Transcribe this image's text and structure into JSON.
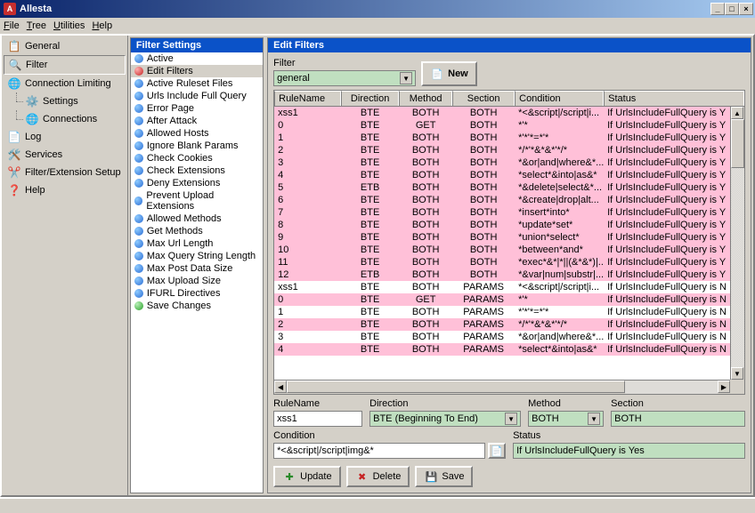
{
  "window": {
    "title": "Allesta",
    "app_abbrev": "A"
  },
  "menu": [
    "File",
    "Tree",
    "Utilities",
    "Help"
  ],
  "nav": [
    {
      "label": "General",
      "icon": "📋"
    },
    {
      "label": "Filter",
      "icon": "🔍",
      "selected": true
    },
    {
      "label": "Connection Limiting",
      "icon": "🌐",
      "children": [
        {
          "label": "Settings",
          "icon": "⚙️"
        },
        {
          "label": "Connections",
          "icon": "🌐"
        }
      ]
    },
    {
      "label": "Log",
      "icon": "📄"
    },
    {
      "label": "Services",
      "icon": "🛠️"
    },
    {
      "label": "Filter/Extension Setup",
      "icon": "✂️"
    },
    {
      "label": "Help",
      "icon": "❓"
    }
  ],
  "filter_settings": {
    "title": "Filter Settings",
    "items": [
      {
        "bullet": "blue",
        "label": "Active"
      },
      {
        "bullet": "red",
        "label": "Edit Filters",
        "selected": true
      },
      {
        "bullet": "blue",
        "label": "Active Ruleset Files"
      },
      {
        "bullet": "blue",
        "label": "Urls Include Full Query"
      },
      {
        "bullet": "blue",
        "label": "Error Page"
      },
      {
        "bullet": "blue",
        "label": "After Attack"
      },
      {
        "bullet": "blue",
        "label": "Allowed Hosts"
      },
      {
        "bullet": "blue",
        "label": "Ignore Blank Params"
      },
      {
        "bullet": "blue",
        "label": "Check Cookies"
      },
      {
        "bullet": "blue",
        "label": "Check Extensions"
      },
      {
        "bullet": "blue",
        "label": "Deny Extensions"
      },
      {
        "bullet": "blue",
        "label": "Prevent Upload Extensions"
      },
      {
        "bullet": "blue",
        "label": "Allowed Methods"
      },
      {
        "bullet": "blue",
        "label": "Get Methods"
      },
      {
        "bullet": "blue",
        "label": "Max Url Length"
      },
      {
        "bullet": "blue",
        "label": "Max Query String Length"
      },
      {
        "bullet": "blue",
        "label": "Max Post Data Size"
      },
      {
        "bullet": "blue",
        "label": "Max Upload Size"
      },
      {
        "bullet": "blue",
        "label": "IFURL Directives"
      },
      {
        "bullet": "green",
        "label": "Save Changes"
      }
    ]
  },
  "edit": {
    "title": "Edit Filters",
    "filter_label": "Filter",
    "filter_value": "general",
    "new_btn": "New",
    "columns": [
      "RuleName",
      "Direction",
      "Method",
      "Section",
      "Condition",
      "Status"
    ],
    "rows": [
      {
        "rule": "xss1",
        "dir": "BTE",
        "meth": "BOTH",
        "sect": "BOTH",
        "cond": "*<&script|/script|i...",
        "stat": "If UrlsIncludeFullQuery is Y",
        "pink": true
      },
      {
        "rule": "0",
        "dir": "BTE",
        "meth": "GET",
        "sect": "BOTH",
        "cond": "*'*",
        "stat": "If UrlsIncludeFullQuery is Y",
        "pink": true
      },
      {
        "rule": "1",
        "dir": "BTE",
        "meth": "BOTH",
        "sect": "BOTH",
        "cond": "*'*'*=*'*",
        "stat": "If UrlsIncludeFullQuery is Y",
        "pink": true
      },
      {
        "rule": "2",
        "dir": "BTE",
        "meth": "BOTH",
        "sect": "BOTH",
        "cond": "*/*'*&*&*'*/*",
        "stat": "If UrlsIncludeFullQuery is Y",
        "pink": true
      },
      {
        "rule": "3",
        "dir": "BTE",
        "meth": "BOTH",
        "sect": "BOTH",
        "cond": "*&or|and|where&*...",
        "stat": "If UrlsIncludeFullQuery is Y",
        "pink": true
      },
      {
        "rule": "4",
        "dir": "BTE",
        "meth": "BOTH",
        "sect": "BOTH",
        "cond": "*select*&into|as&*",
        "stat": "If UrlsIncludeFullQuery is Y",
        "pink": true
      },
      {
        "rule": "5",
        "dir": "ETB",
        "meth": "BOTH",
        "sect": "BOTH",
        "cond": "*&delete|select&*...",
        "stat": "If UrlsIncludeFullQuery is Y",
        "pink": true
      },
      {
        "rule": "6",
        "dir": "BTE",
        "meth": "BOTH",
        "sect": "BOTH",
        "cond": "*&create|drop|alt...",
        "stat": "If UrlsIncludeFullQuery is Y",
        "pink": true
      },
      {
        "rule": "7",
        "dir": "BTE",
        "meth": "BOTH",
        "sect": "BOTH",
        "cond": "*insert*into*",
        "stat": "If UrlsIncludeFullQuery is Y",
        "pink": true
      },
      {
        "rule": "8",
        "dir": "BTE",
        "meth": "BOTH",
        "sect": "BOTH",
        "cond": "*update*set*",
        "stat": "If UrlsIncludeFullQuery is Y",
        "pink": true
      },
      {
        "rule": "9",
        "dir": "BTE",
        "meth": "BOTH",
        "sect": "BOTH",
        "cond": "*union*select*",
        "stat": "If UrlsIncludeFullQuery is Y",
        "pink": true
      },
      {
        "rule": "10",
        "dir": "BTE",
        "meth": "BOTH",
        "sect": "BOTH",
        "cond": "*between*and*",
        "stat": "If UrlsIncludeFullQuery is Y",
        "pink": true
      },
      {
        "rule": "11",
        "dir": "BTE",
        "meth": "BOTH",
        "sect": "BOTH",
        "cond": "*exec*&*|*||(&*&*)|...",
        "stat": "If UrlsIncludeFullQuery is Y",
        "pink": true
      },
      {
        "rule": "12",
        "dir": "ETB",
        "meth": "BOTH",
        "sect": "BOTH",
        "cond": "*&var|num|substr|...",
        "stat": "If UrlsIncludeFullQuery is Y",
        "pink": true
      },
      {
        "rule": "xss1",
        "dir": "BTE",
        "meth": "BOTH",
        "sect": "PARAMS",
        "cond": "*<&script|/script|i...",
        "stat": "If UrlsIncludeFullQuery is N",
        "pink": false
      },
      {
        "rule": "0",
        "dir": "BTE",
        "meth": "GET",
        "sect": "PARAMS",
        "cond": "*'*",
        "stat": "If UrlsIncludeFullQuery is N",
        "pink": true
      },
      {
        "rule": "1",
        "dir": "BTE",
        "meth": "BOTH",
        "sect": "PARAMS",
        "cond": "*'*'*=*'*",
        "stat": "If UrlsIncludeFullQuery is N",
        "pink": false
      },
      {
        "rule": "2",
        "dir": "BTE",
        "meth": "BOTH",
        "sect": "PARAMS",
        "cond": "*/*'*&*&*'*/*",
        "stat": "If UrlsIncludeFullQuery is N",
        "pink": true
      },
      {
        "rule": "3",
        "dir": "BTE",
        "meth": "BOTH",
        "sect": "PARAMS",
        "cond": "*&or|and|where&*...",
        "stat": "If UrlsIncludeFullQuery is N",
        "pink": false
      },
      {
        "rule": "4",
        "dir": "BTE",
        "meth": "BOTH",
        "sect": "PARAMS",
        "cond": "*select*&into|as&*",
        "stat": "If UrlsIncludeFullQuery is N",
        "pink": true
      }
    ],
    "form": {
      "rule_label": "RuleName",
      "rule_value": "xss1",
      "dir_label": "Direction",
      "dir_value": "BTE (Beginning To End)",
      "meth_label": "Method",
      "meth_value": "BOTH",
      "sect_label": "Section",
      "sect_value": "BOTH",
      "cond_label": "Condition",
      "cond_value": "*<&script|/script|img&*",
      "stat_label": "Status",
      "stat_value": "If UrlsIncludeFullQuery is Yes",
      "update": "Update",
      "delete": "Delete",
      "save": "Save"
    }
  }
}
